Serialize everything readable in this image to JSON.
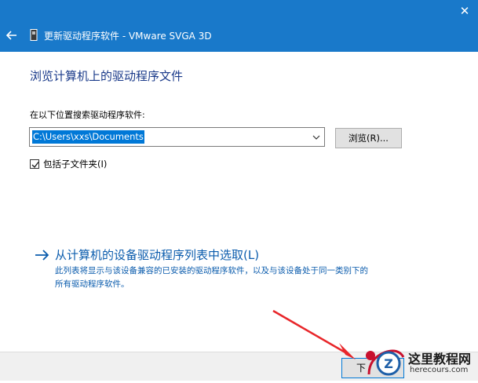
{
  "window": {
    "title": "更新驱动程序软件 - VMware SVGA 3D",
    "close_label": "✕"
  },
  "main": {
    "heading": "浏览计算机上的驱动程序文件",
    "search_label": "在以下位置搜索驱动程序软件:",
    "path_value": "C:\\Users\\xxs\\Documents",
    "browse_label": "浏览(R)...",
    "include_subfolders_label": "包括子文件夹(I)",
    "include_subfolders_checked": true
  },
  "pick_option": {
    "title": "从计算机的设备驱动程序列表中选取(L)",
    "desc_line1": "此列表将显示与该设备兼容的已安装的驱动程序软件，以及与该设备处于同一类别下的",
    "desc_line2": "所有驱动程序软件。"
  },
  "footer": {
    "next_label": "下"
  },
  "watermark": {
    "name": "这里教程网",
    "url": "herecours.com",
    "logo_letter": "Z"
  },
  "colors": {
    "titlebar": "#1979ca",
    "link": "#0b5cad",
    "selection": "#0078d7",
    "annotation": "#e8262a"
  }
}
